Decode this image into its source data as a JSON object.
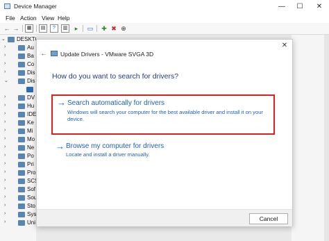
{
  "window": {
    "title": "Device Manager",
    "controls": {
      "minimize": "—",
      "maximize": "☐",
      "close": "✕"
    }
  },
  "menu": [
    "File",
    "Action",
    "View",
    "Help"
  ],
  "tree": {
    "items": [
      {
        "chevron": "⌄",
        "label": "DESKTO"
      },
      {
        "chevron": "›",
        "label": "Au"
      },
      {
        "chevron": "›",
        "label": "Ba"
      },
      {
        "chevron": "›",
        "label": "Co"
      },
      {
        "chevron": "›",
        "label": "Dis"
      },
      {
        "chevron": "⌄",
        "label": "Dis"
      },
      {
        "chevron": "",
        "label": ""
      },
      {
        "chevron": "›",
        "label": "DV"
      },
      {
        "chevron": "›",
        "label": "Hu"
      },
      {
        "chevron": "›",
        "label": "IDE"
      },
      {
        "chevron": "›",
        "label": "Ke"
      },
      {
        "chevron": "›",
        "label": "Mi"
      },
      {
        "chevron": "›",
        "label": "Mo"
      },
      {
        "chevron": "›",
        "label": "Ne"
      },
      {
        "chevron": "›",
        "label": "Po"
      },
      {
        "chevron": "›",
        "label": "Pri"
      },
      {
        "chevron": "›",
        "label": "Pro"
      },
      {
        "chevron": "›",
        "label": "SCS"
      },
      {
        "chevron": "›",
        "label": "Sof"
      },
      {
        "chevron": "›",
        "label": "Sou"
      },
      {
        "chevron": "›",
        "label": "Sto"
      },
      {
        "chevron": "›",
        "label": "Sys"
      },
      {
        "chevron": "›",
        "label": "Uni"
      }
    ]
  },
  "dialog": {
    "title": "Update Drivers - VMware SVGA 3D",
    "close": "✕",
    "back": "←",
    "question": "How do you want to search for drivers?",
    "options": [
      {
        "arrow": "→",
        "title": "Search automatically for drivers",
        "description": "Windows will search your computer for the best available driver and install it on your device."
      },
      {
        "arrow": "→",
        "title": "Browse my computer for drivers",
        "description": "Locate and install a driver manually."
      }
    ],
    "cancel_label": "Cancel"
  },
  "colors": {
    "highlight_border": "#e11d1d",
    "link_blue": "#1f5fb4",
    "heading_blue": "#1f3a8a"
  }
}
